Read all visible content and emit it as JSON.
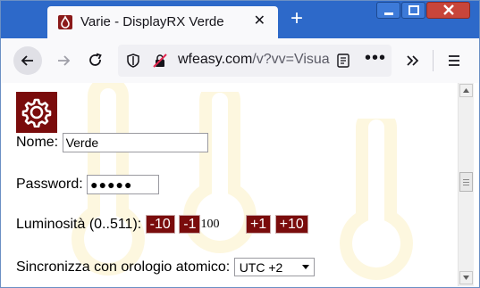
{
  "window": {
    "tab_title": "Varie - DisplayRX Verde",
    "close_glyph": "✕",
    "new_tab_glyph": "+",
    "accent_color": "#2d69c9"
  },
  "toolbar": {
    "url_host": "wfeasy.com",
    "url_rest": "/v?vv=Visua",
    "more_glyph": "•••"
  },
  "form": {
    "name_label": "Nome:",
    "name_value": "Verde",
    "password_label": "Password:",
    "password_value": "●●●●●",
    "brightness_label": "Luminosità (0..511):",
    "btn_minus10": "-10",
    "btn_minus1": "-1",
    "brightness_value": "100",
    "btn_plus1": "+1",
    "btn_plus10": "+10",
    "sync_label": "Sincronizza con orologio atomico:",
    "sync_selected": "UTC +2",
    "brand_color": "#7a0c0c"
  },
  "icons": [
    "favicon-icon",
    "close-icon",
    "plus-icon",
    "back-arrow-icon",
    "forward-arrow-icon",
    "reload-icon",
    "shield-icon",
    "insecure-lock-icon",
    "reader-view-icon",
    "overflow-chevron-icon",
    "hamburger-menu-icon",
    "gear-icon",
    "thermometer-icon"
  ]
}
